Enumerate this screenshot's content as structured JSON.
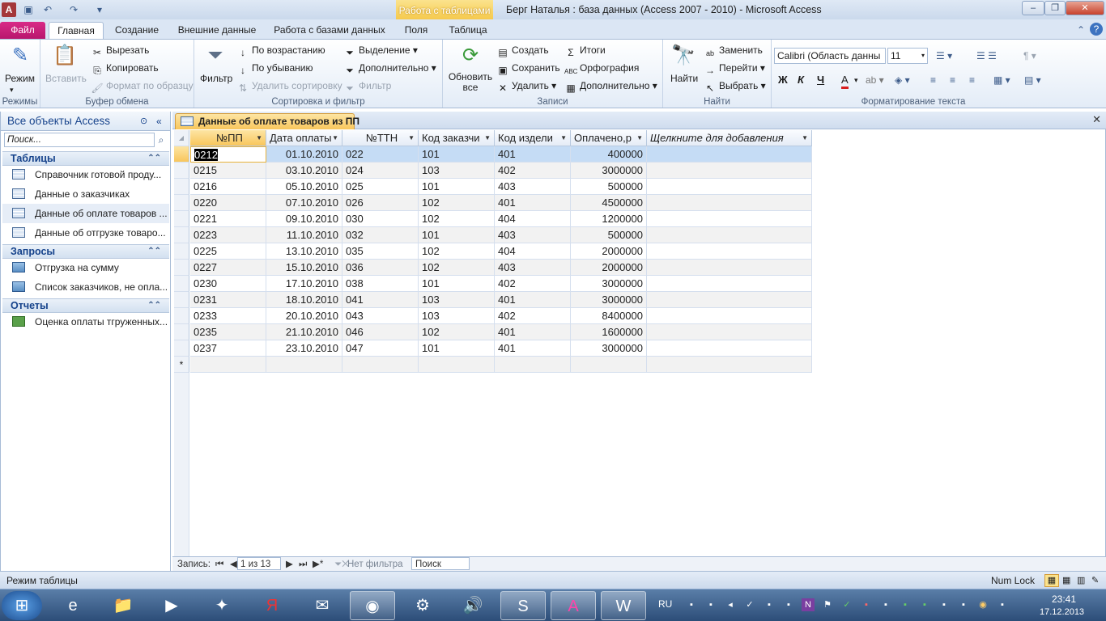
{
  "window": {
    "title": "Берг Наталья : база данных (Access 2007 - 2010)  -  Microsoft Access",
    "context_tab_header": "Работа с таблицами"
  },
  "ribbon_tabs": [
    "Файл",
    "Главная",
    "Создание",
    "Внешние данные",
    "Работа с базами данных",
    "Поля",
    "Таблица"
  ],
  "ribbon": {
    "modes": {
      "view": "Режим",
      "label": "Режимы"
    },
    "clipboard": {
      "paste": "Вставить",
      "cut": "Вырезать",
      "copy": "Копировать",
      "format_painter": "Формат по образцу",
      "label": "Буфер обмена"
    },
    "sort_filter": {
      "filter": "Фильтр",
      "ascending": "По возрастанию",
      "descending": "По убыванию",
      "remove_sort": "Удалить сортировку",
      "selection": "Выделение",
      "advanced": "Дополнительно",
      "toggle_filter": "Фильтр",
      "label": "Сортировка и фильтр"
    },
    "records": {
      "refresh": "Обновить все",
      "new": "Создать",
      "save": "Сохранить",
      "delete": "Удалить",
      "totals": "Итоги",
      "spelling": "Орфография",
      "more": "Дополнительно",
      "label": "Записи"
    },
    "find": {
      "find": "Найти",
      "replace": "Заменить",
      "goto": "Перейти",
      "select": "Выбрать",
      "label": "Найти"
    },
    "text_format": {
      "font": "Calibri (Область данны",
      "size": "11",
      "bold": "Ж",
      "italic": "К",
      "underline": "Ч",
      "label": "Форматирование текста"
    }
  },
  "nav": {
    "header": "Все объекты Access",
    "search_placeholder": "Поиск...",
    "sections": [
      {
        "title": "Таблицы",
        "items": [
          "Справочник готовой проду...",
          "Данные о заказчиках",
          "Данные об оплате товаров ...",
          "Данные об отгрузке товаро..."
        ]
      },
      {
        "title": "Запросы",
        "items": [
          "Отгрузка на сумму",
          "Список заказчиков, не опла..."
        ]
      },
      {
        "title": "Отчеты",
        "items": [
          "Оценка оплаты тгруженных..."
        ]
      }
    ]
  },
  "document": {
    "tab_title": "Данные об оплате товаров из ПП",
    "columns": [
      "№ПП",
      "Дата оплаты",
      "№ТТН",
      "Код заказчи",
      "Код издели",
      "Оплачено,р",
      "Щелкните для добавления"
    ],
    "rows": [
      [
        "0212",
        "01.10.2010",
        "022",
        "101",
        "401",
        "400000"
      ],
      [
        "0215",
        "03.10.2010",
        "024",
        "103",
        "402",
        "3000000"
      ],
      [
        "0216",
        "05.10.2010",
        "025",
        "101",
        "403",
        "500000"
      ],
      [
        "0220",
        "07.10.2010",
        "026",
        "102",
        "401",
        "4500000"
      ],
      [
        "0221",
        "09.10.2010",
        "030",
        "102",
        "404",
        "1200000"
      ],
      [
        "0223",
        "11.10.2010",
        "032",
        "101",
        "403",
        "500000"
      ],
      [
        "0225",
        "13.10.2010",
        "035",
        "102",
        "404",
        "2000000"
      ],
      [
        "0227",
        "15.10.2010",
        "036",
        "102",
        "403",
        "2000000"
      ],
      [
        "0230",
        "17.10.2010",
        "038",
        "101",
        "402",
        "3000000"
      ],
      [
        "0231",
        "18.10.2010",
        "041",
        "103",
        "401",
        "3000000"
      ],
      [
        "0233",
        "20.10.2010",
        "043",
        "103",
        "402",
        "8400000"
      ],
      [
        "0235",
        "21.10.2010",
        "046",
        "102",
        "401",
        "1600000"
      ],
      [
        "0237",
        "23.10.2010",
        "047",
        "101",
        "401",
        "3000000"
      ]
    ],
    "new_row_marker": "*"
  },
  "record_nav": {
    "label": "Запись:",
    "position": "1 из 13",
    "filter": "Нет фильтра",
    "search": "Поиск"
  },
  "status": {
    "left": "Режим таблицы",
    "numlock": "Num Lock"
  },
  "taskbar": {
    "lang": "RU",
    "time": "23:41",
    "date": "17.12.2013"
  },
  "colors": {
    "file_tab": "#c31f78",
    "accent": "#15428b",
    "selection": "#c5dcf5"
  }
}
